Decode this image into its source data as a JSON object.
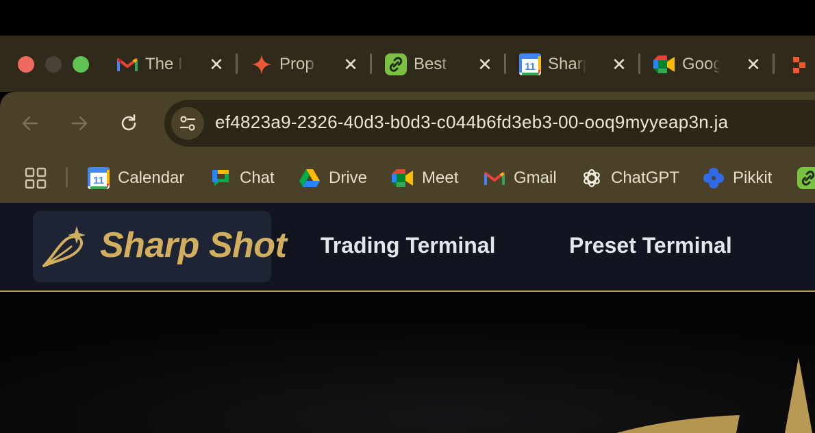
{
  "browser": {
    "tabs": [
      {
        "title": "The I",
        "icon": "gmail-icon"
      },
      {
        "title": "Prop",
        "icon": "gemini-icon"
      },
      {
        "title": "Best",
        "icon": "link-icon"
      },
      {
        "title": "Sharp",
        "icon": "calendar-icon"
      },
      {
        "title": "Goog",
        "icon": "meet-icon"
      }
    ],
    "tab_close_glyph": "✕",
    "url": "ef4823a9-2326-40d3-b0d3-c044b6fd3eb3-00-ooq9myyeap3n.ja",
    "bookmarks": [
      {
        "label": "Calendar",
        "icon": "calendar-icon"
      },
      {
        "label": "Chat",
        "icon": "google-chat-icon"
      },
      {
        "label": "Drive",
        "icon": "google-drive-icon"
      },
      {
        "label": "Meet",
        "icon": "meet-icon"
      },
      {
        "label": "Gmail",
        "icon": "gmail-icon"
      },
      {
        "label": "ChatGPT",
        "icon": "chatgpt-icon"
      },
      {
        "label": "Pikkit",
        "icon": "pikkit-icon"
      }
    ],
    "calendar_day": "11"
  },
  "site": {
    "logo_text": "Sharp Shot",
    "nav": [
      "Trading Terminal",
      "Preset Terminal"
    ]
  },
  "colors": {
    "tabstrip": "#2f2a1a",
    "toolbar": "#4a4128",
    "header": "#111520",
    "brand_gold": "#d2af5e"
  }
}
